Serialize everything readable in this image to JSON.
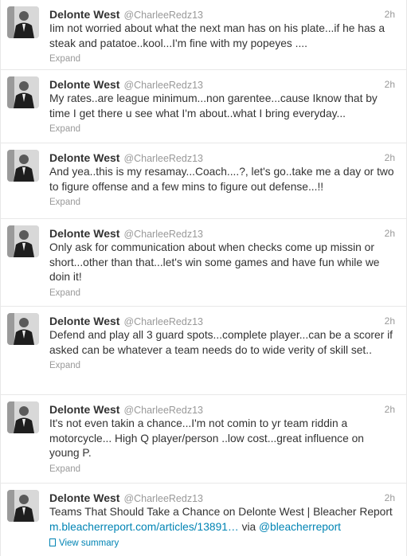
{
  "tweets": [
    {
      "name": "Delonte West",
      "handle": "@CharleeRedz13",
      "time": "2h",
      "text": "Iim not worried about what the next man has on his plate...if he has a steak and patatoe..kool...I'm fine with my popeyes ....",
      "action": "Expand"
    },
    {
      "name": "Delonte West",
      "handle": "@CharleeRedz13",
      "time": "2h",
      "text": "My rates..are league minimum...non garentee...cause Iknow that by time I get there u see what I'm about..what I bring everyday...",
      "action": "Expand"
    },
    {
      "name": "Delonte West",
      "handle": "@CharleeRedz13",
      "time": "2h",
      "text": "And yea..this is my resamay...Coach....?, let's go..take me a day or two to figure offense and a few mins to figure out defense...!!",
      "action": "Expand"
    },
    {
      "name": "Delonte West",
      "handle": "@CharleeRedz13",
      "time": "2h",
      "text": "Only ask for communication about when checks come up missin or short...other than that...let's win some games and have fun while we doin it!",
      "action": "Expand"
    },
    {
      "name": "Delonte West",
      "handle": "@CharleeRedz13",
      "time": "2h",
      "text": "Defend and play all 3 guard spots...complete player...can be a scorer if asked can be whatever a team needs do to wide verity of skill set..",
      "action": "Expand"
    },
    {
      "name": "Delonte West",
      "handle": "@CharleeRedz13",
      "time": "2h",
      "text": "It's not even takin a chance...I'm not comin to yr team riddin a motorcycle... High Q player/person ..low cost...great influence on young P.",
      "action": "Expand"
    },
    {
      "name": "Delonte West",
      "handle": "@CharleeRedz13",
      "time": "2h",
      "text_pre": "Teams That Should Take a Chance on Delonte West | Bleacher Report ",
      "link": "m.bleacherreport.com/articles/13891…",
      "text_mid": " via ",
      "mention": "@bleacherreport",
      "action": "View summary"
    }
  ],
  "colors": {
    "link": "#0084b4",
    "meta": "#999999",
    "text": "#333333",
    "divider": "#e8e8e8"
  }
}
